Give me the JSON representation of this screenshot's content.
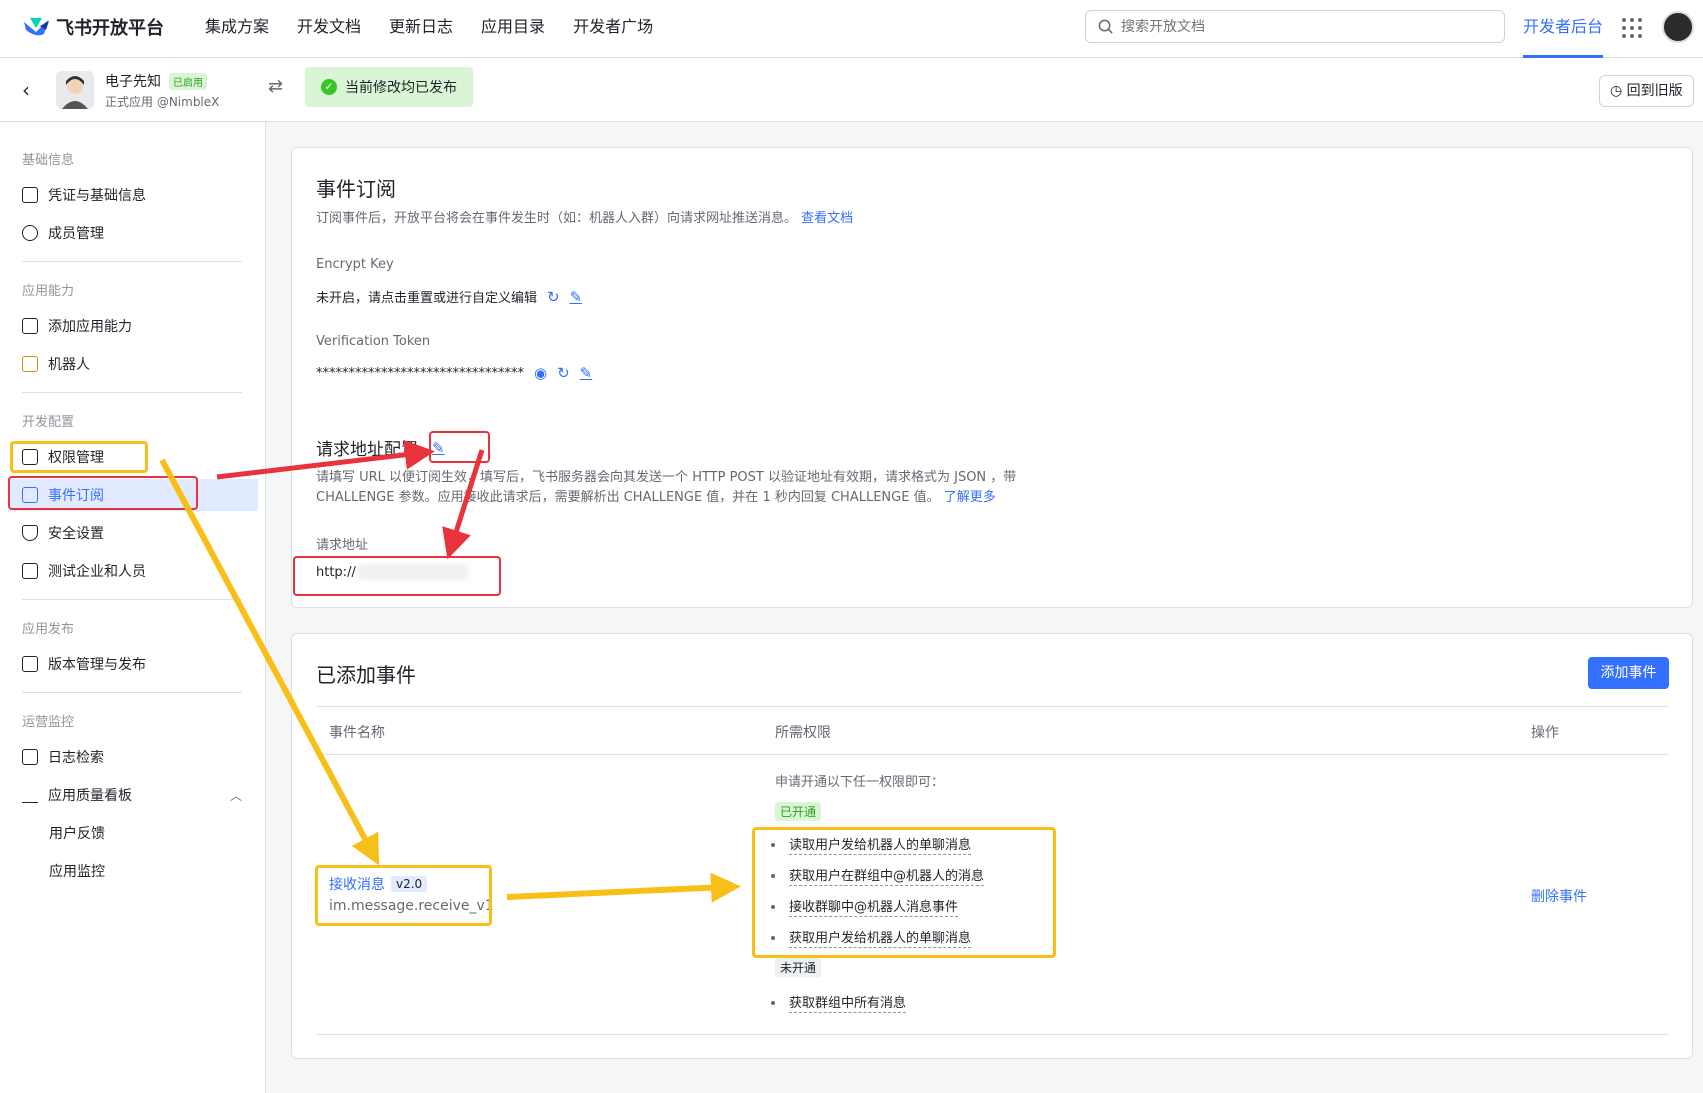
{
  "topnav": {
    "logo_text": "飞书开放平台",
    "links": [
      "集成方案",
      "开发文档",
      "更新日志",
      "应用目录",
      "开发者广场"
    ],
    "search_placeholder": "搜索开放文档",
    "dev_console": "开发者后台"
  },
  "app": {
    "name": "电子先知",
    "status_badge": "已启用",
    "subtitle": "正式应用 @NimbleX",
    "published_text": "当前修改均已发布",
    "old_version_button": "回到旧版"
  },
  "sidebar": {
    "groups": [
      {
        "title": "基础信息",
        "items": [
          "凭证与基础信息",
          "成员管理"
        ]
      },
      {
        "title": "应用能力",
        "items": [
          "添加应用能力",
          "机器人"
        ]
      },
      {
        "title": "开发配置",
        "items": [
          "权限管理",
          "事件订阅",
          "安全设置",
          "测试企业和人员"
        ]
      },
      {
        "title": "应用发布",
        "items": [
          "版本管理与发布"
        ]
      },
      {
        "title": "运营监控",
        "items": [
          "日志检索",
          "应用质量看板"
        ],
        "subitems": [
          "用户反馈",
          "应用监控"
        ]
      }
    ],
    "active_item": "事件订阅"
  },
  "event_sub": {
    "title": "事件订阅",
    "desc": "订阅事件后，开放平台将会在事件发生时（如：机器人入群）向请求网址推送消息。",
    "doc_link": "查看文档",
    "encrypt_label": "Encrypt Key",
    "encrypt_value": "未开启，请点击重置或进行自定义编辑",
    "token_label": "Verification Token",
    "token_value": "********************************",
    "request_title": "请求地址配置",
    "request_desc_1": "请填写 URL 以便订阅生效，填写后，飞书服务器会向其发送一个 HTTP POST 以验证地址有效期，请求格式为 JSON ，带",
    "request_desc_2": "CHALLENGE 参数。应用接收此请求后，需要解析出 CHALLENGE 值，并在 1 秒内回复 CHALLENGE 值。",
    "learn_more": "了解更多",
    "url_label": "请求地址",
    "url_value": "http://"
  },
  "added_events": {
    "title": "已添加事件",
    "add_button": "添加事件",
    "columns": [
      "事件名称",
      "所需权限",
      "操作"
    ],
    "perm_hint": "申请开通以下任一权限即可：",
    "enabled_tag": "已开通",
    "enabled_perms": [
      "读取用户发给机器人的单聊消息",
      "获取用户在群组中@机器人的消息",
      "接收群聊中@机器人消息事件",
      "获取用户发给机器人的单聊消息"
    ],
    "disabled_tag": "未开通",
    "disabled_perms": [
      "获取群组中所有消息"
    ],
    "event_name": "接收消息",
    "event_version": "v2.0",
    "event_code": "im.message.receive_v1",
    "delete_action": "删除事件"
  },
  "colors": {
    "accent": "#3370ff",
    "success": "#34c724",
    "annot_red": "#e8323c",
    "annot_yellow": "#f9bf19"
  }
}
